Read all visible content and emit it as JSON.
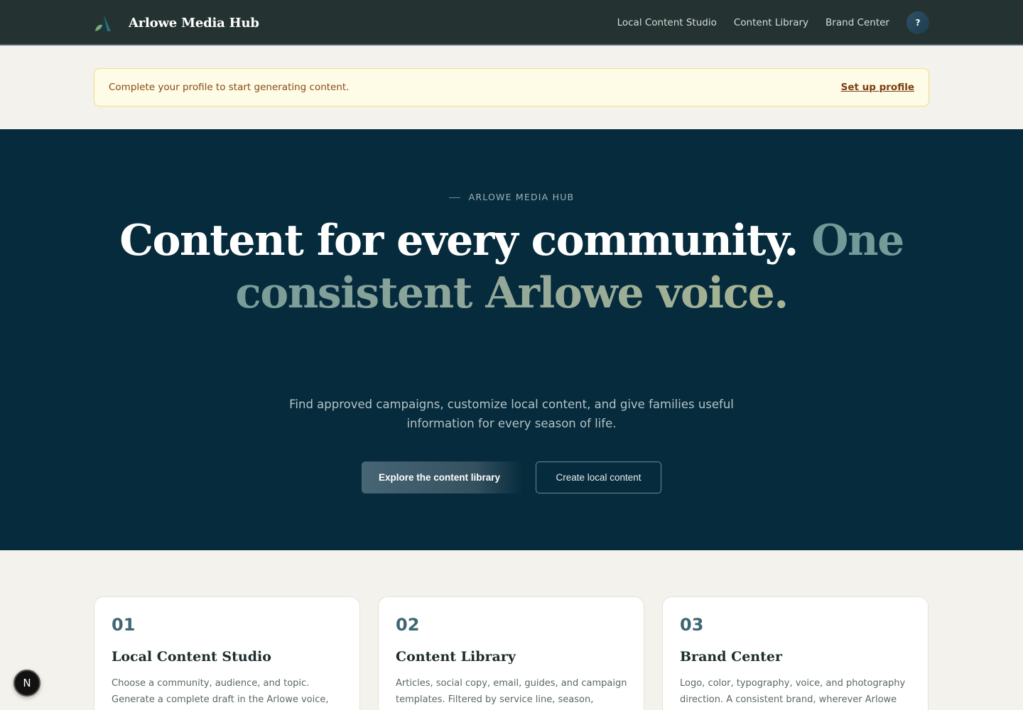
{
  "header": {
    "brand_name": "Arlowe Media Hub",
    "logo_icon": "mountain-leaf-icon",
    "nav": [
      {
        "label": "Local Content Studio"
      },
      {
        "label": "Content Library"
      },
      {
        "label": "Brand Center"
      }
    ],
    "help_label": "?"
  },
  "notice": {
    "text": "Complete your profile to start generating content.",
    "link": "Set up profile"
  },
  "hero": {
    "eyebrow": "ARLOWE MEDIA HUB",
    "headline_plain": "Content for every community.",
    "headline_accent": "One consistent Arlowe voice.",
    "subcopy": "Find approved campaigns, customize local content, and give families useful information for every season of life.",
    "primary_button": "Explore the content library",
    "secondary_button": "Create local content"
  },
  "cards": [
    {
      "num": "01",
      "title": "Local Content Studio",
      "desc": "Choose a community, audience, and topic. Generate a complete draft in the Arlowe voice,"
    },
    {
      "num": "02",
      "title": "Content Library",
      "desc": "Articles, social copy, email, guides, and campaign templates. Filtered by service line, season,"
    },
    {
      "num": "03",
      "title": "Brand Center",
      "desc": "Logo, color, typography, voice, and photography direction. A consistent brand, wherever Arlowe"
    }
  ],
  "badge": {
    "label": "N"
  },
  "colors": {
    "header_bg": "#243331",
    "hero_bg": "#062b3c",
    "page_bg": "#f4f2ec",
    "accent": "#3f6675"
  }
}
